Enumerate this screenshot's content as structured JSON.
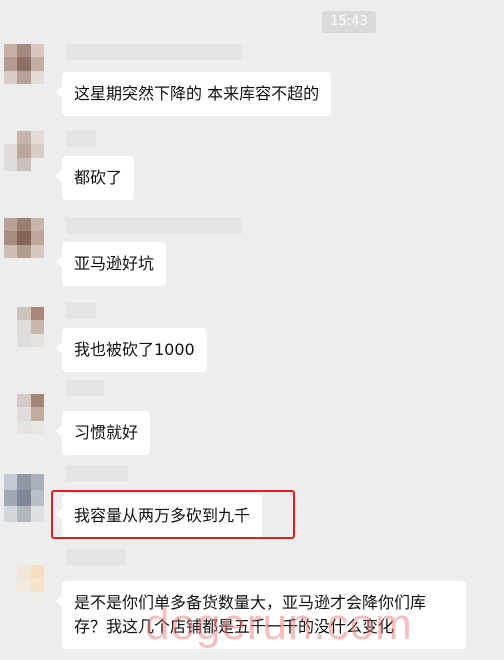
{
  "chat": {
    "timestamp": "15:43",
    "messages": [
      {
        "text": "这星期突然下降的   本来库容不超的"
      },
      {
        "text": "都砍了"
      },
      {
        "text": "亚马逊好坑"
      },
      {
        "text": "我也被砍了1000"
      },
      {
        "text": "习惯就好"
      },
      {
        "text": "我容量从两万多砍到九千"
      },
      {
        "text": "是不是你们单多备货数量大，亚马逊才会降你们库存？我这几个店铺都是五千一千的没什么变化"
      }
    ]
  },
  "watermark": "dogerun.com"
}
